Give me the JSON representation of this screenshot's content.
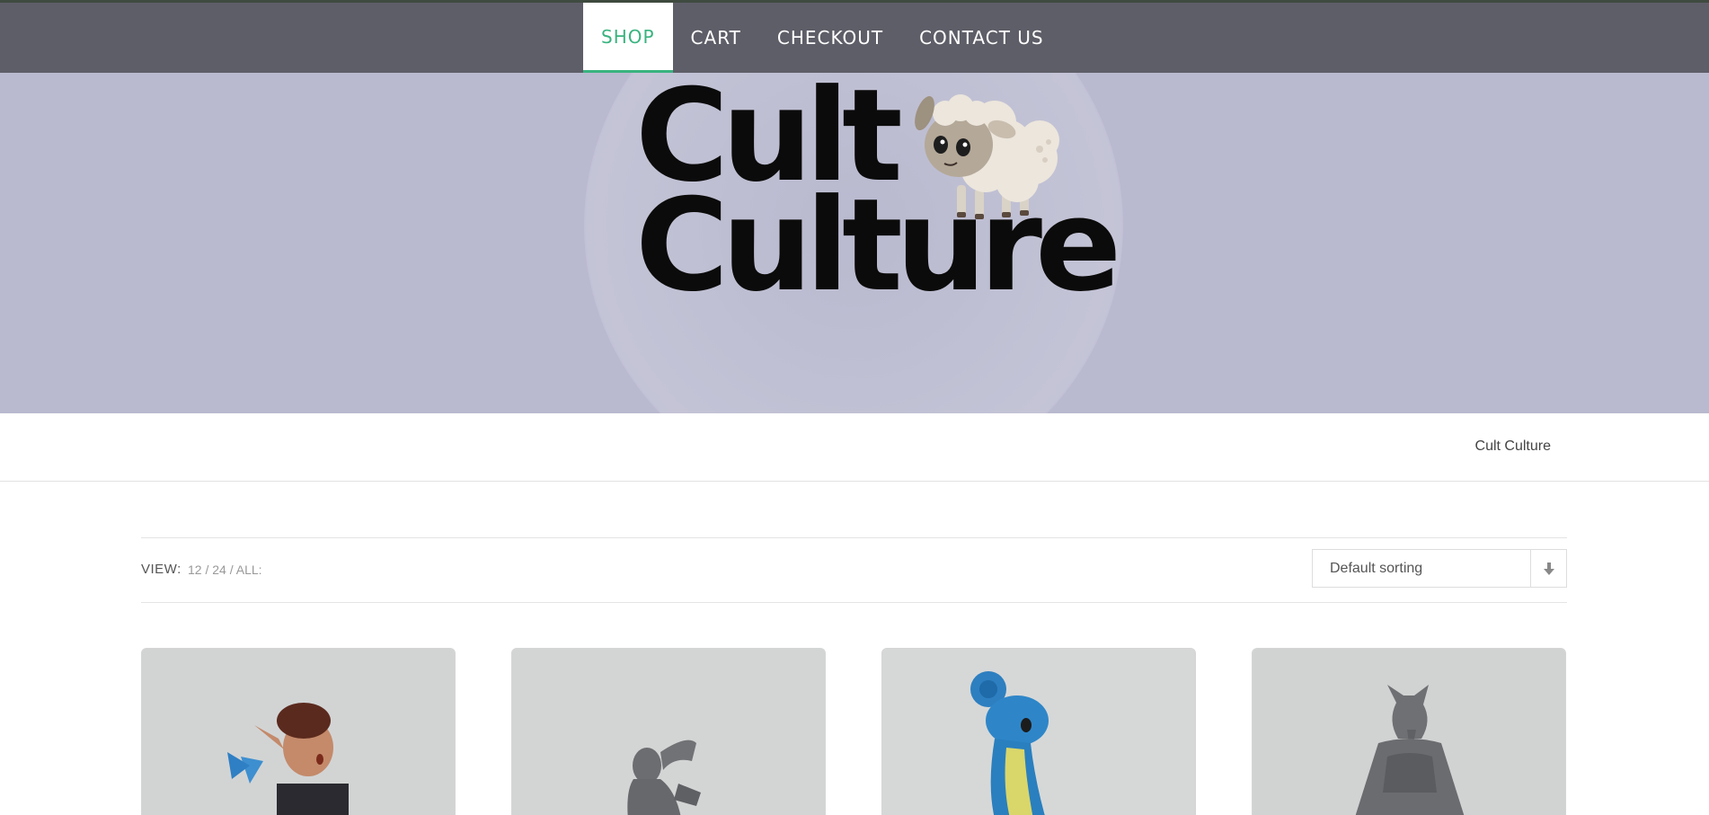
{
  "nav": {
    "items": [
      {
        "label": "SHOP",
        "active": true
      },
      {
        "label": "CART",
        "active": false
      },
      {
        "label": "CHECKOUT",
        "active": false
      },
      {
        "label": "CONTACT US",
        "active": false
      }
    ]
  },
  "hero": {
    "logo_line1": "Cult",
    "logo_line2": "Culture"
  },
  "breadcrumb": "Cult Culture",
  "toolbar": {
    "view_label": "VIEW:",
    "view_12": "12",
    "sep1": "/",
    "view_24": "24",
    "sep2": "/",
    "view_all": "ALL:",
    "sorting_value": "Default sorting",
    "sorting_icon": "arrow-down-icon"
  },
  "colors": {
    "navbar": "#5e5e68",
    "accent": "#39b37f",
    "hero_bg": "#b9b9cf"
  },
  "products": [
    {
      "image": "elf-archer-miniature"
    },
    {
      "image": "crouching-warrior-miniature"
    },
    {
      "image": "blue-sea-creature-figure"
    },
    {
      "image": "wolf-cloaked-miniature"
    }
  ]
}
